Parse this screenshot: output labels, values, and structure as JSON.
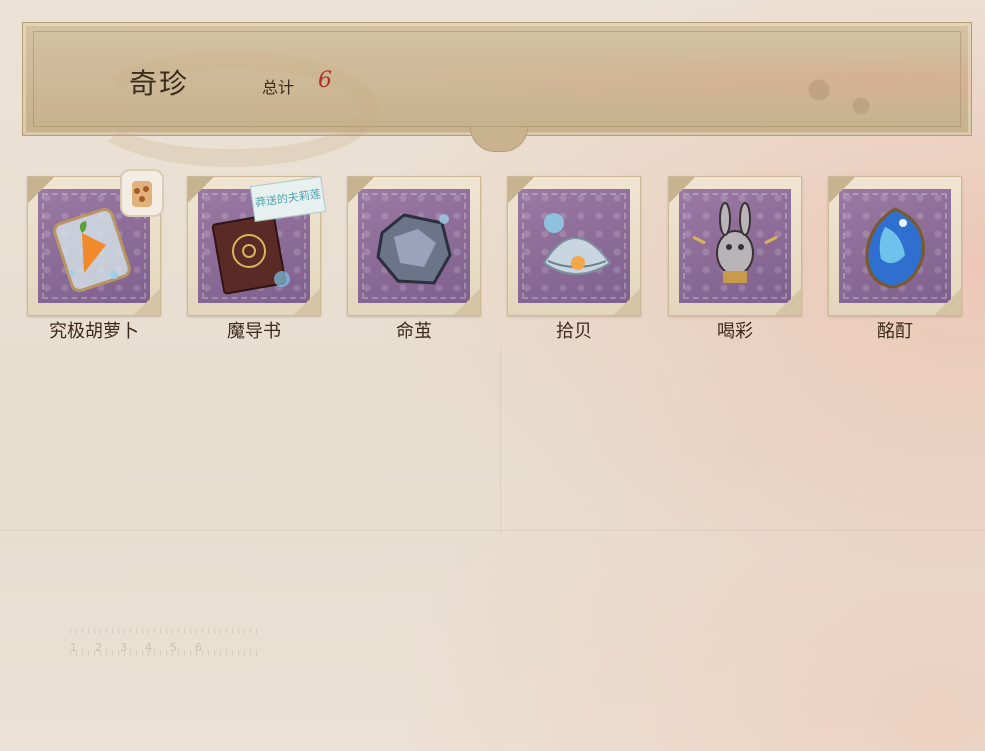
{
  "header": {
    "title": "奇珍",
    "total_label": "总计",
    "total_value": "6"
  },
  "items": [
    {
      "name": "究极胡萝卜",
      "icon": "carrot-jar-icon"
    },
    {
      "name": "魔导书",
      "icon": "spellbook-icon",
      "tag": "莽送的夫莉莲"
    },
    {
      "name": "命茧",
      "icon": "cocoon-icon"
    },
    {
      "name": "拾贝",
      "icon": "seashell-pearl-icon"
    },
    {
      "name": "喝彩",
      "icon": "rabbit-cheer-icon"
    },
    {
      "name": "酩酊",
      "icon": "blue-gem-icon"
    }
  ],
  "colors": {
    "accent_total": "#b0302a",
    "stamp_purple": "#8a6b95",
    "banner": "#c7b08c"
  }
}
